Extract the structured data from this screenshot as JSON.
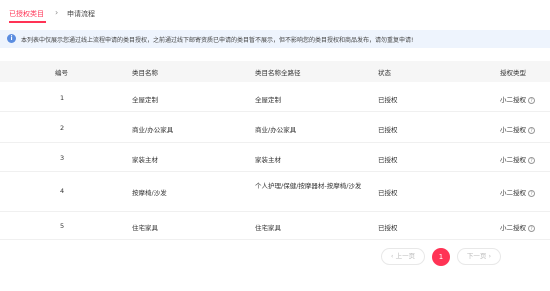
{
  "tabs": {
    "active": "已授权类目",
    "separator": "›",
    "inactive": "申请流程"
  },
  "notice": {
    "icon": "info-icon",
    "text": "本列表中仅展示您通过线上流程申请的类目授权，之前通过线下邮寄资质已申请的类目暂不展示，但不影响您的类目授权和商品发布，请勿重复申请!"
  },
  "table": {
    "headers": [
      "编号",
      "类目名称",
      "类目名称全路径",
      "状态",
      "授权类型"
    ],
    "rows": [
      {
        "id": "1",
        "name": "全屋定制",
        "path": "全屋定制",
        "status": "已授权",
        "auth": "小二授权"
      },
      {
        "id": "2",
        "name": "商业/办公家具",
        "path": "商业/办公家具",
        "status": "已授权",
        "auth": "小二授权"
      },
      {
        "id": "3",
        "name": "家装主材",
        "path": "家装主材",
        "status": "已授权",
        "auth": "小二授权"
      },
      {
        "id": "4",
        "name": "按摩椅/沙发",
        "path": "个人护理/保健/按摩器材-按摩椅/沙发",
        "status": "已授权",
        "auth": "小二授权"
      },
      {
        "id": "5",
        "name": "住宅家具",
        "path": "住宅家具",
        "status": "已授权",
        "auth": "小二授权"
      }
    ]
  },
  "pagination": {
    "prev": "‹ 上一页",
    "current": "1",
    "next": "下一页 ›"
  },
  "colors": {
    "accent": "#ff3355",
    "notice_bg": "#eef4fd",
    "header_bg": "#f6f6f6"
  }
}
